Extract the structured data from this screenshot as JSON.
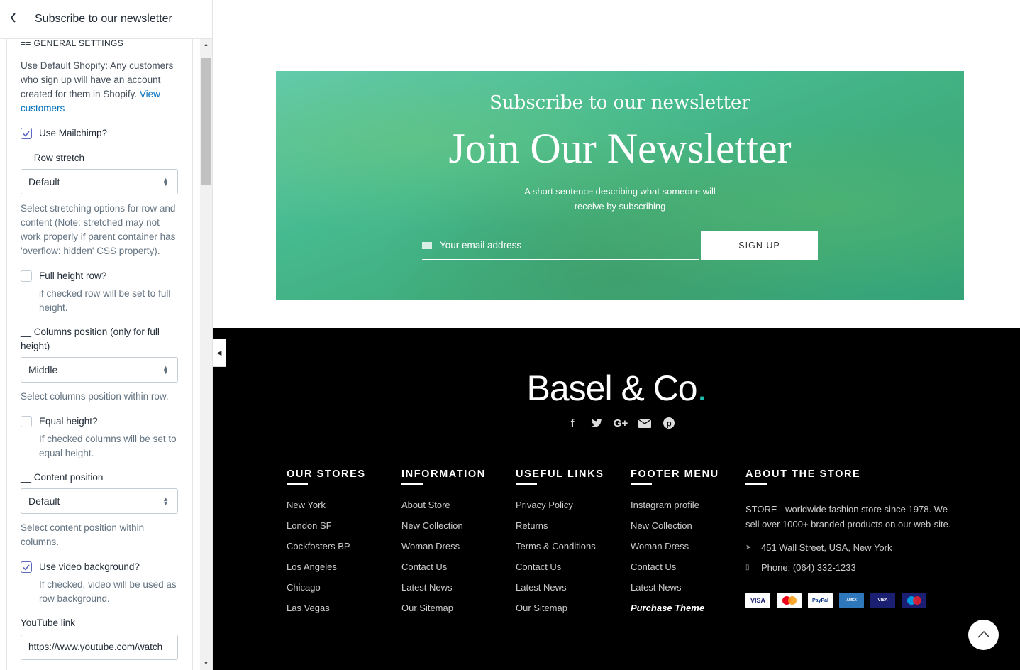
{
  "panel": {
    "title": "Subscribe to our newsletter",
    "section_heading": "== GENERAL SETTINGS",
    "intro_text": "Use Default Shopify: Any customers who sign up will have an account created for them in Shopify.",
    "intro_link": "View customers",
    "use_mailchimp": {
      "label": "Use Mailchimp?",
      "checked": true
    },
    "row_stretch": {
      "label": "__ Row stretch",
      "value": "Default",
      "hint": "Select stretching options for row and content (Note: stretched may not work properly if parent container has 'overflow: hidden' CSS property)."
    },
    "full_height": {
      "label": "Full height row?",
      "checked": false,
      "hint": "if checked row will be set to full height."
    },
    "columns_position": {
      "label": "__ Columns position (only for full height)",
      "value": "Middle",
      "hint": "Select columns position within row."
    },
    "equal_height": {
      "label": "Equal height?",
      "checked": false,
      "hint": "If checked columns will be set to equal height."
    },
    "content_position": {
      "label": "__ Content position",
      "value": "Default",
      "hint": "Select content position within columns."
    },
    "video_background": {
      "label": "Use video background?",
      "checked": true,
      "hint": "If checked, video will be used as row background."
    },
    "youtube": {
      "label": "YouTube link",
      "value": "https://www.youtube.com/watch"
    }
  },
  "newsletter": {
    "subtitle": "Subscribe to our newsletter",
    "title": "Join Our Newsletter",
    "description": "A short sentence describing what someone will receive by subscribing",
    "email_placeholder": "Your email address",
    "signup_label": "SIGN UP"
  },
  "footer": {
    "logo": "Basel & Co",
    "logo_dot": ".",
    "socials": [
      "facebook-icon",
      "twitter-icon",
      "google-plus-icon",
      "envelope-icon",
      "pinterest-icon"
    ],
    "columns": [
      {
        "heading": "OUR STORES",
        "items": [
          "New York",
          "London SF",
          "Cockfosters BP",
          "Los Angeles",
          "Chicago",
          "Las Vegas"
        ]
      },
      {
        "heading": "INFORMATION",
        "items": [
          "About Store",
          "New Collection",
          "Woman Dress",
          "Contact Us",
          "Latest News",
          "Our Sitemap"
        ]
      },
      {
        "heading": "USEFUL LINKS",
        "items": [
          "Privacy Policy",
          "Returns",
          "Terms & Conditions",
          "Contact Us",
          "Latest News",
          "Our Sitemap"
        ]
      },
      {
        "heading": "FOOTER MENU",
        "items": [
          "Instagram profile",
          "New Collection",
          "Woman Dress",
          "Contact Us",
          "Latest News",
          "Purchase Theme"
        ]
      }
    ],
    "about": {
      "heading": "ABOUT THE STORE",
      "text": "STORE - worldwide fashion store since 1978. We sell over 1000+ branded products on our web-site.",
      "address": "451 Wall Street, USA, New York",
      "phone": "Phone: (064) 332-1233",
      "payments": [
        "VISA",
        "MasterCard",
        "PayPal",
        "AMERICAN EXPRESS",
        "VISA Electron",
        "Maestro"
      ]
    }
  },
  "colors": {
    "accent": "#1fbfb1",
    "link": "#006fbb",
    "checkbox": "#5c6ac4",
    "footer_bg": "#000000"
  }
}
